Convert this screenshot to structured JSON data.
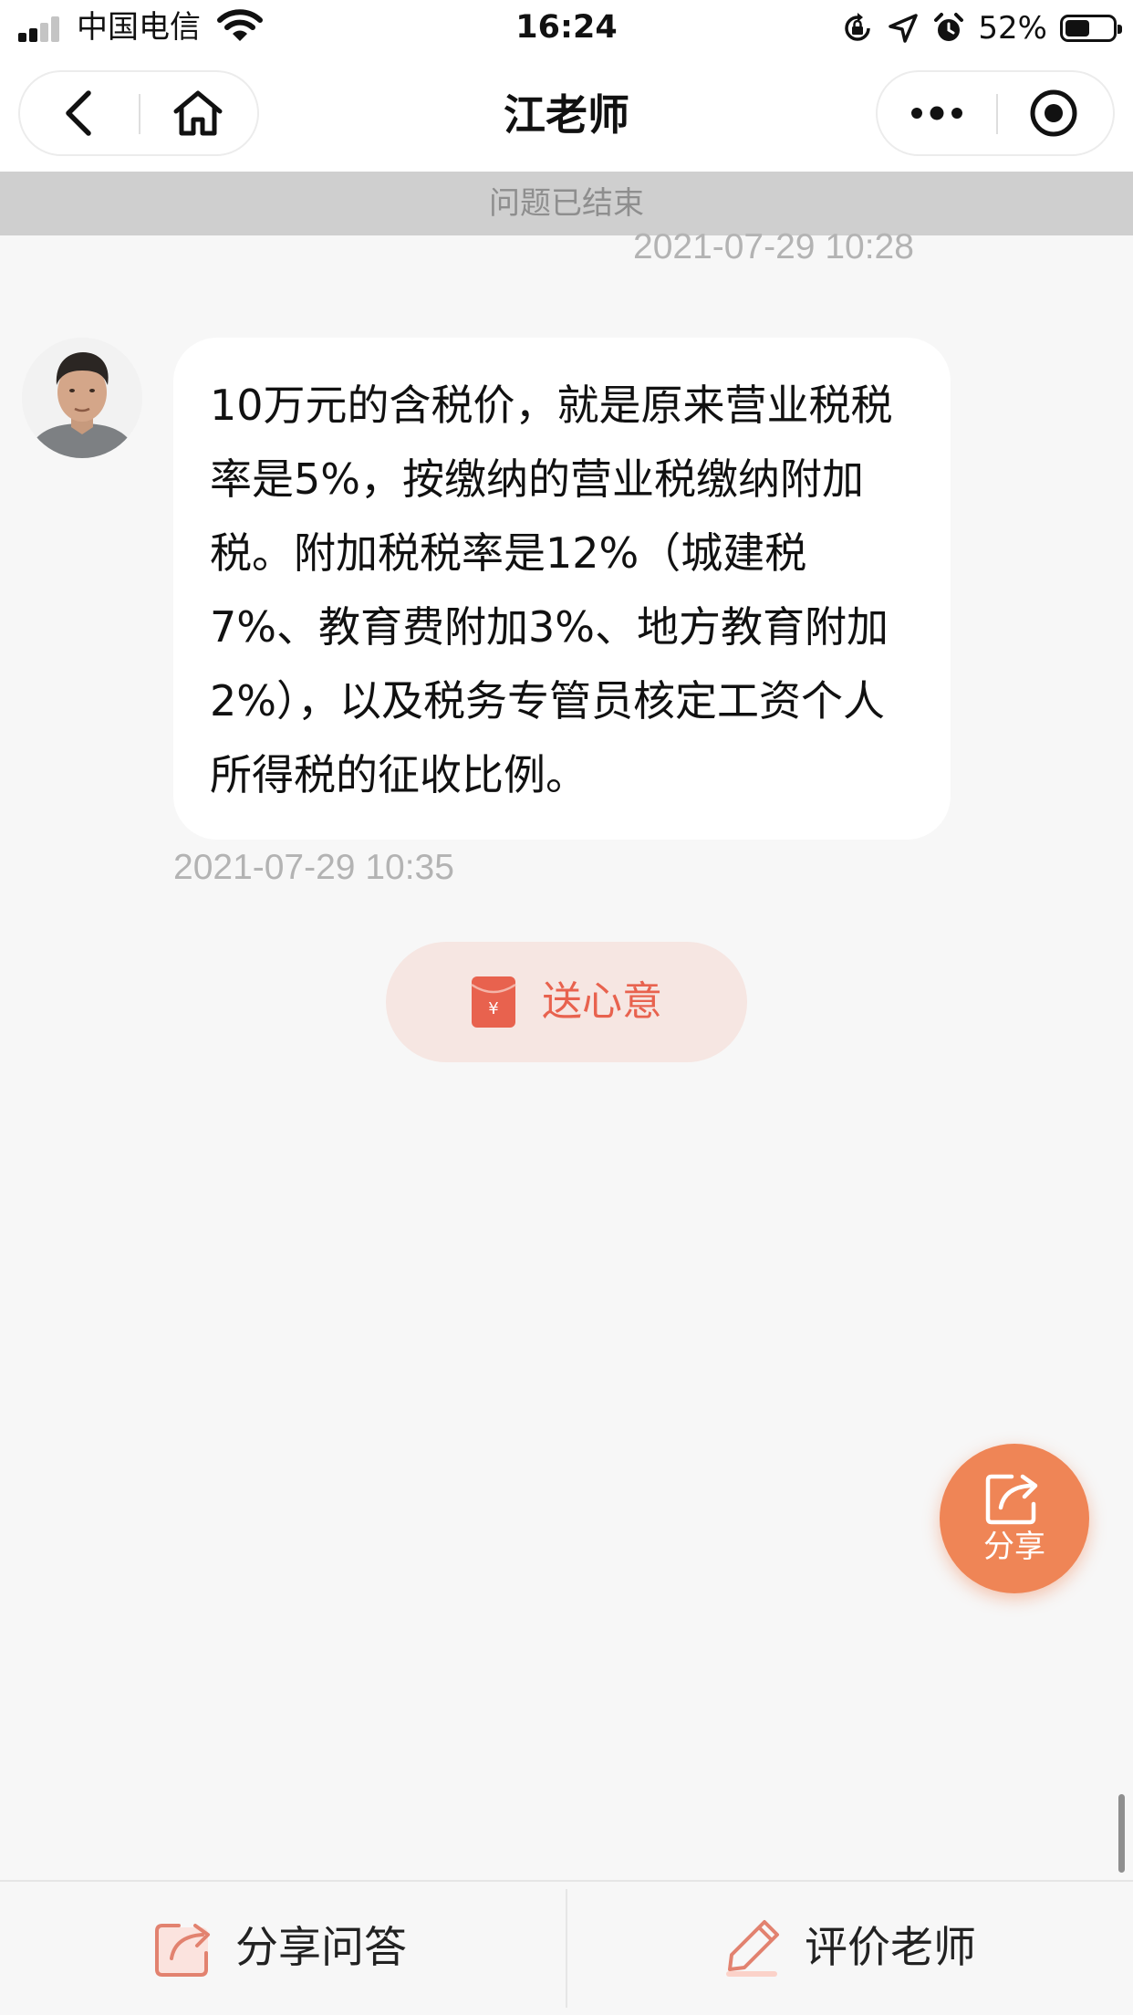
{
  "status_bar": {
    "carrier": "中国电信",
    "time": "16:24",
    "battery_percent": "52%",
    "battery_level": 0.52,
    "icons": [
      "signal-icon",
      "wifi-icon",
      "orientation-lock-icon",
      "location-icon",
      "alarm-icon",
      "battery-icon"
    ]
  },
  "nav": {
    "title": "江老师",
    "left_icons": [
      "back-icon",
      "home-icon"
    ],
    "right_icons": [
      "more-icon",
      "close-mini-program-icon"
    ]
  },
  "banner": {
    "text": "问题已结束"
  },
  "prev_timestamp": "2021-07-29 10:28",
  "message": {
    "text": "10万元的含税价，就是原来营业税税率是5%，按缴纳的营业税缴纳附加税。附加税税率是12%（城建税7%、教育费附加3%、地方教育附加2%），以及税务专管员核定工资个人所得税的征收比例。",
    "timestamp": "2021-07-29 10:35"
  },
  "tip_button": {
    "label": "送心意",
    "icon": "red-envelope-icon",
    "color": "#e8624e"
  },
  "share_fab": {
    "label": "分享",
    "icon": "share-icon",
    "color": "#ef8556"
  },
  "bottom_bar": {
    "share_label": "分享问答",
    "rate_label": "评价老师"
  }
}
